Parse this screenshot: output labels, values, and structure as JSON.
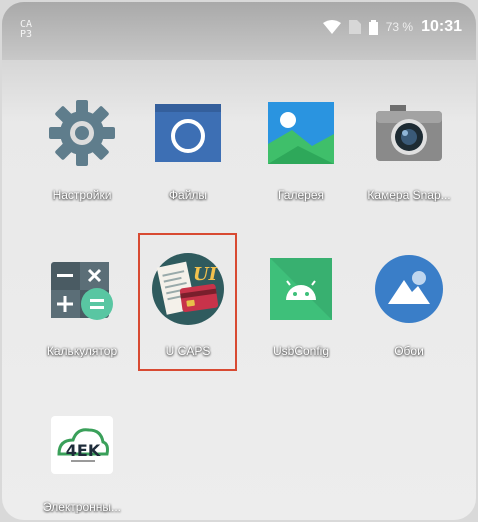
{
  "status_bar": {
    "left_badge": "CA\nP3",
    "battery_text": "73 %",
    "time": "10:31"
  },
  "apps": [
    {
      "label": "Настройки",
      "icon": "settings-icon"
    },
    {
      "label": "Файлы",
      "icon": "files-icon"
    },
    {
      "label": "Галерея",
      "icon": "gallery-icon"
    },
    {
      "label": "Камера Snap...",
      "icon": "camera-icon"
    },
    {
      "label": "Калькулятор",
      "icon": "calculator-icon"
    },
    {
      "label": "U CAPS",
      "icon": "ucaps-icon",
      "highlighted": true
    },
    {
      "label": "UsbConfig",
      "icon": "android-icon"
    },
    {
      "label": "Обои",
      "icon": "wallpaper-icon"
    },
    {
      "label": "Электронны...",
      "icon": "4ek-icon"
    }
  ],
  "ucaps_badge": "UI",
  "ek_logo_text": "4EK",
  "colors": {
    "highlight": "#d84a32",
    "gear": "#5f7d8c",
    "files": "#3d6fb4",
    "gallery_sky": "#2a94e0",
    "android_green": "#3ec07a",
    "wallpaper_blue": "#3a7ec8",
    "ucaps_bg": "#2f5b5e"
  }
}
